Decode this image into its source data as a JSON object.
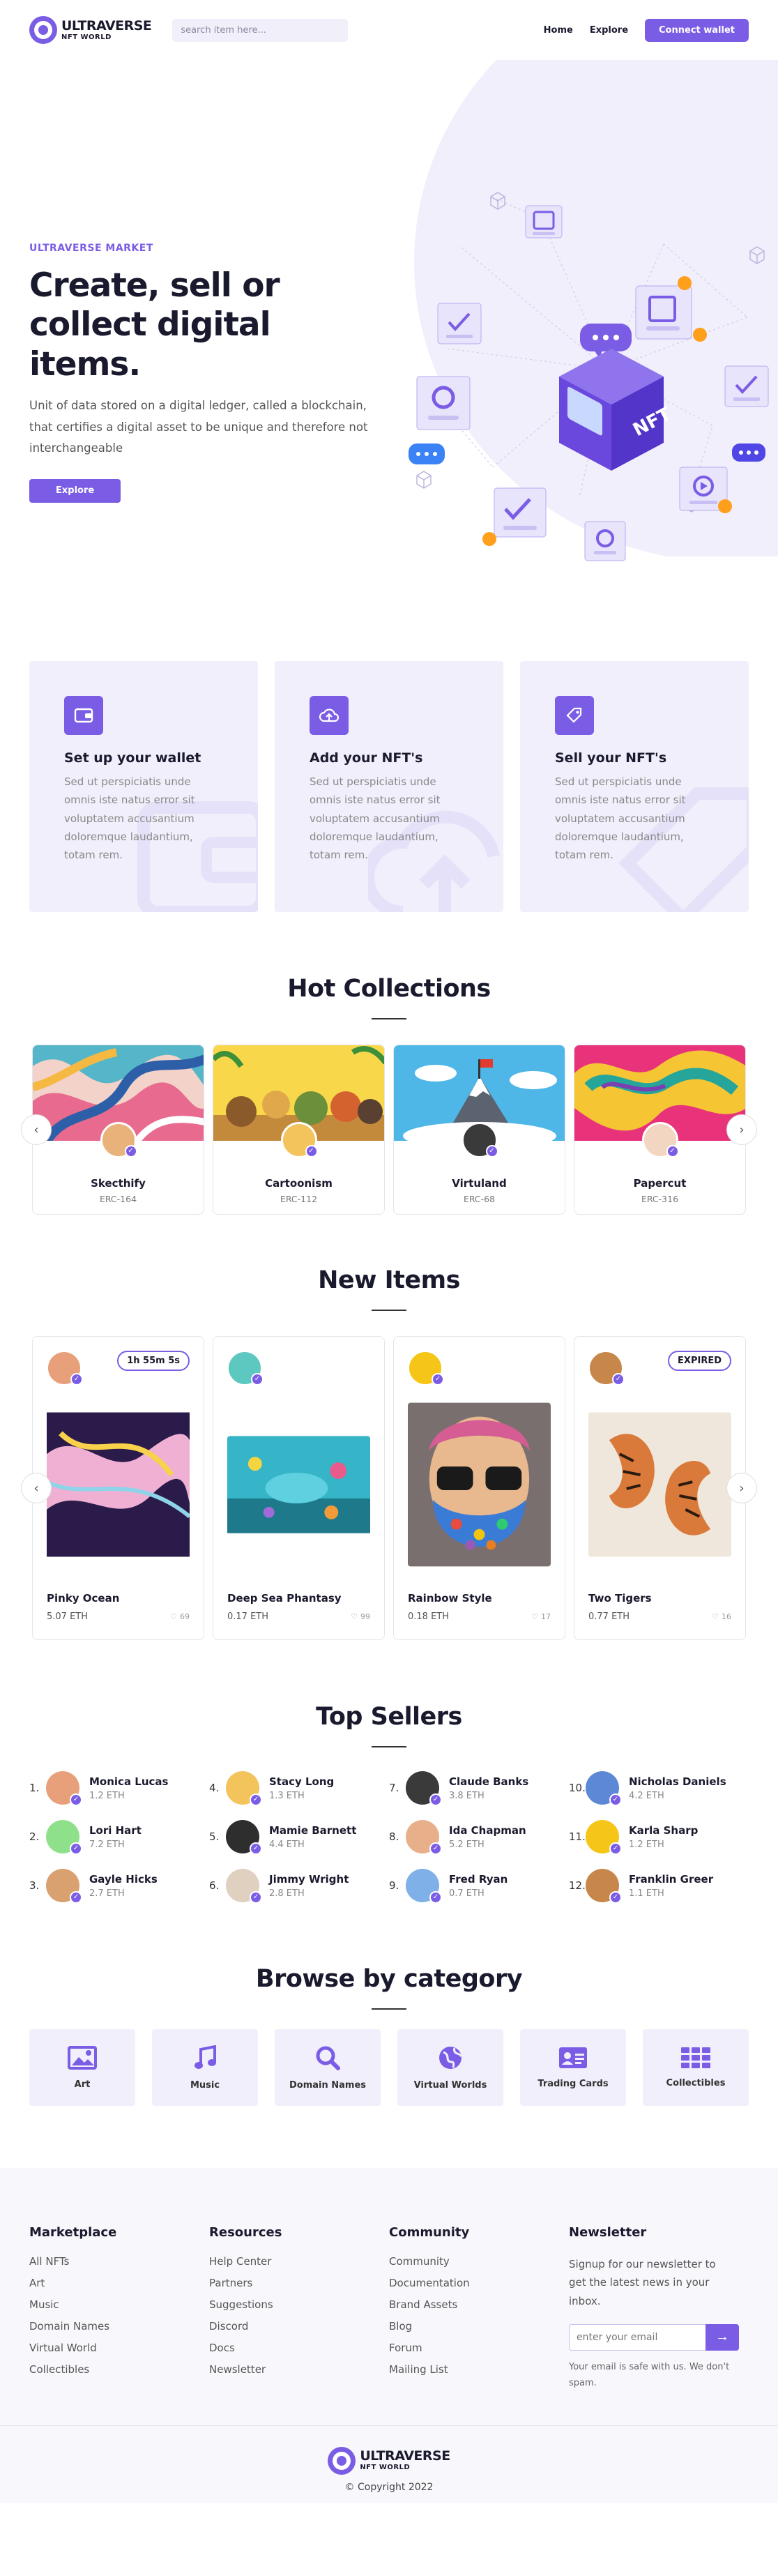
{
  "brand": {
    "line1": "ULTRAVERSE",
    "line2": "NFT WORLD"
  },
  "nav": {
    "search_placeholder": "search item here...",
    "links": [
      "Home",
      "Explore"
    ],
    "connect_label": "Connect wallet"
  },
  "hero": {
    "kicker": "ULTRAVERSE MARKET",
    "title": "Create, sell or collect digital items.",
    "description": "Unit of data stored on a digital ledger, called a blockchain, that certifies a digital asset to be unique and therefore not interchangeable",
    "button": "Explore",
    "art_label": "NFT"
  },
  "features": [
    {
      "icon": "wallet-icon",
      "title": "Set up your wallet",
      "text": "Sed ut perspiciatis unde omnis iste natus error sit voluptatem accusantium doloremque laudantium, totam rem."
    },
    {
      "icon": "cloud-upload-icon",
      "title": "Add your NFT's",
      "text": "Sed ut perspiciatis unde omnis iste natus error sit voluptatem accusantium doloremque laudantium, totam rem."
    },
    {
      "icon": "tag-icon",
      "title": "Sell your NFT's",
      "text": "Sed ut perspiciatis unde omnis iste natus error sit voluptatem accusantium doloremque laudantium, totam rem."
    }
  ],
  "hot_collections": {
    "title": "Hot Collections",
    "items": [
      {
        "name": "Skecthify",
        "code": "ERC-164"
      },
      {
        "name": "Cartoonism",
        "code": "ERC-112"
      },
      {
        "name": "Virtuland",
        "code": "ERC-68"
      },
      {
        "name": "Papercut",
        "code": "ERC-316"
      }
    ]
  },
  "new_items": {
    "title": "New Items",
    "items": [
      {
        "name": "Pinky Ocean",
        "price": "5.07 ETH",
        "likes": "69",
        "badge": "1h 55m 5s"
      },
      {
        "name": "Deep Sea Phantasy",
        "price": "0.17 ETH",
        "likes": "99",
        "badge": ""
      },
      {
        "name": "Rainbow Style",
        "price": "0.18 ETH",
        "likes": "17",
        "badge": ""
      },
      {
        "name": "Two Tigers",
        "price": "0.77 ETH",
        "likes": "16",
        "badge": "EXPIRED"
      }
    ]
  },
  "top_sellers": {
    "title": "Top Sellers",
    "items": [
      {
        "rank": "1.",
        "name": "Monica Lucas",
        "eth": "1.2 ETH"
      },
      {
        "rank": "4.",
        "name": "Stacy Long",
        "eth": "1.3 ETH"
      },
      {
        "rank": "7.",
        "name": "Claude Banks",
        "eth": "3.8 ETH"
      },
      {
        "rank": "10.",
        "name": "Nicholas Daniels",
        "eth": "4.2 ETH"
      },
      {
        "rank": "2.",
        "name": "Lori Hart",
        "eth": "7.2 ETH"
      },
      {
        "rank": "5.",
        "name": "Mamie Barnett",
        "eth": "4.4 ETH"
      },
      {
        "rank": "8.",
        "name": "Ida Chapman",
        "eth": "5.2 ETH"
      },
      {
        "rank": "11.",
        "name": "Karla Sharp",
        "eth": "1.2 ETH"
      },
      {
        "rank": "3.",
        "name": "Gayle Hicks",
        "eth": "2.7 ETH"
      },
      {
        "rank": "6.",
        "name": "Jimmy Wright",
        "eth": "2.8 ETH"
      },
      {
        "rank": "9.",
        "name": "Fred Ryan",
        "eth": "0.7 ETH"
      },
      {
        "rank": "12.",
        "name": "Franklin Greer",
        "eth": "1.1 ETH"
      }
    ]
  },
  "categories": {
    "title": "Browse by category",
    "items": [
      {
        "label": "Art",
        "icon": "image-icon"
      },
      {
        "label": "Music",
        "icon": "music-icon"
      },
      {
        "label": "Domain Names",
        "icon": "search-icon"
      },
      {
        "label": "Virtual Worlds",
        "icon": "globe-icon"
      },
      {
        "label": "Trading Cards",
        "icon": "id-card-icon"
      },
      {
        "label": "Collectibles",
        "icon": "grid-icon"
      }
    ]
  },
  "footer": {
    "marketplace": {
      "title": "Marketplace",
      "links": [
        "All NFTs",
        "Art",
        "Music",
        "Domain Names",
        "Virtual World",
        "Collectibles"
      ]
    },
    "resources": {
      "title": "Resources",
      "links": [
        "Help Center",
        "Partners",
        "Suggestions",
        "Discord",
        "Docs",
        "Newsletter"
      ]
    },
    "community": {
      "title": "Community",
      "links": [
        "Community",
        "Documentation",
        "Brand Assets",
        "Blog",
        "Forum",
        "Mailing List"
      ]
    },
    "newsletter": {
      "title": "Newsletter",
      "text": "Signup for our newsletter to get the latest news in your inbox.",
      "placeholder": "enter your email",
      "note": "Your email is safe with us. We don't spam."
    },
    "copyright": "© Copyright 2022"
  },
  "colors": {
    "accent": "#7b5ce5",
    "tint": "#f1effb"
  }
}
